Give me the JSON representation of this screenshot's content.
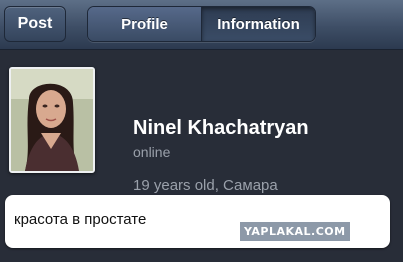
{
  "navbar": {
    "back_label": "Post",
    "tabs": [
      {
        "label": "Profile",
        "selected": false
      },
      {
        "label": "Information",
        "selected": true
      }
    ]
  },
  "profile": {
    "name": "Ninel Khachatryan",
    "status": "online",
    "details": "19 years old, Самара"
  },
  "message": {
    "text": "красота в простате"
  },
  "watermark": {
    "text": "YAPLAKAL.COM"
  },
  "colors": {
    "navbar": "#3e4e66",
    "background": "#282d38",
    "name_text": "#ffffff",
    "secondary_text": "#9aa0aa"
  }
}
